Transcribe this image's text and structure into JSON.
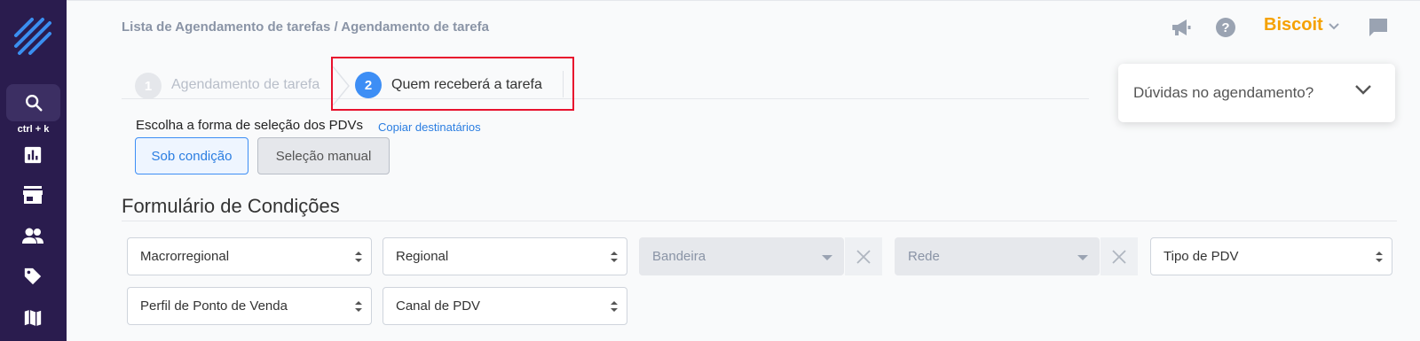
{
  "sidebar": {
    "search_shortcut": "ctrl + k",
    "icons": [
      "logo-icon",
      "search-icon",
      "analytics-icon",
      "store-icon",
      "users-icon",
      "tag-icon",
      "map-icon"
    ],
    "bg": "#2a1c4e"
  },
  "breadcrumb": "Lista de Agendamento de tarefas / Agendamento de tarefa",
  "header": {
    "brand": "Biscoit"
  },
  "steps": [
    {
      "number": "1",
      "label": "Agendamento de tarefa"
    },
    {
      "number": "2",
      "label": "Quem receberá a tarefa"
    }
  ],
  "selection": {
    "label": "Escolha a forma de seleção dos PDVs",
    "copy_link": "Copiar destinatários",
    "by_condition": "Sob condição",
    "manual": "Seleção manual"
  },
  "form": {
    "title": "Formulário de Condições",
    "fields": {
      "macro": "Macrorregional",
      "regional": "Regional",
      "bandeira": "Bandeira",
      "rede": "Rede",
      "tipo_pdv": "Tipo de PDV",
      "perfil": "Perfil de Ponto de Venda",
      "canal": "Canal de PDV"
    }
  },
  "help": {
    "label": "Dúvidas no agendamento?"
  },
  "colors": {
    "accent": "#3d8ef5",
    "highlight": "#e8112d",
    "brand": "#f5a100"
  }
}
